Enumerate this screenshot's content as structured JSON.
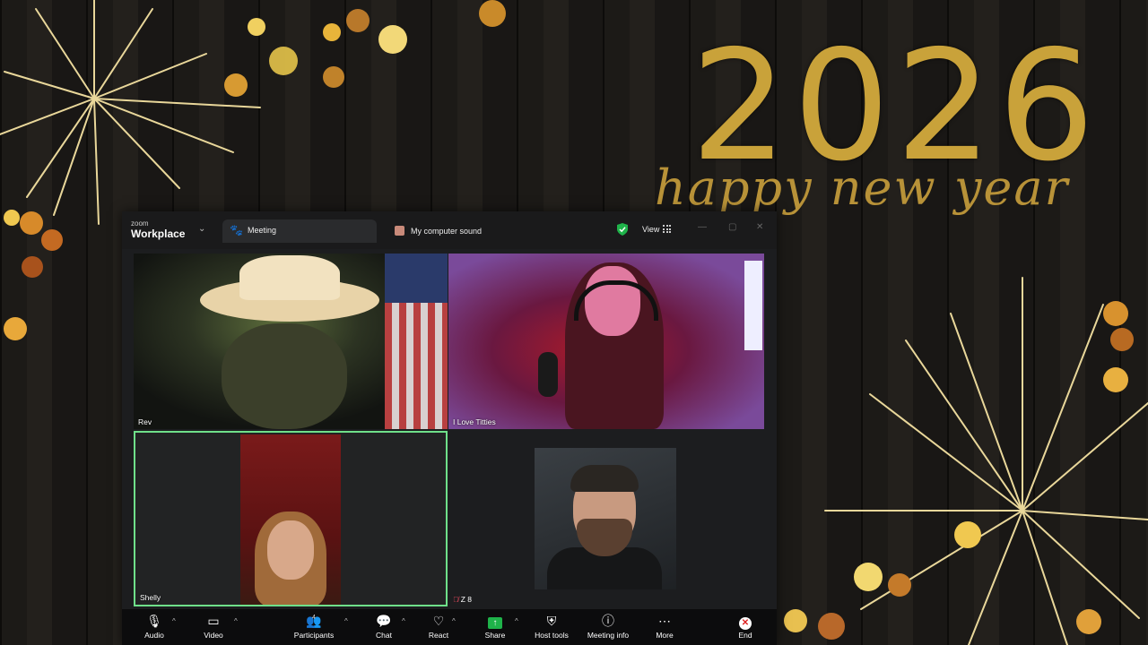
{
  "background": {
    "year": "2026",
    "greeting": "happy new year",
    "colors": {
      "gold": "#c9a23a",
      "wood": "#1c1a17"
    }
  },
  "window": {
    "brand_small": "zoom",
    "brand_big": "Workplace",
    "tabs": [
      {
        "label": "Meeting",
        "icon": "paw-icon",
        "active": true
      },
      {
        "label": "My computer sound",
        "icon": "sound-share-icon",
        "active": false
      }
    ],
    "view_label": "View"
  },
  "participants": [
    {
      "name": "Rev"
    },
    {
      "name": "I Love Titties"
    },
    {
      "name": "Shelly",
      "active_speaker": true
    },
    {
      "name": "Z 8",
      "muted": true
    }
  ],
  "toolbar": {
    "audio": "Audio",
    "video": "Video",
    "participants": "Participants",
    "participants_count": "4",
    "chat": "Chat",
    "react": "React",
    "share": "Share",
    "host_tools": "Host tools",
    "meeting_info": "Meeting info",
    "more": "More",
    "end": "End",
    "colors": {
      "share": "#1fb34a",
      "end": "#dd2222",
      "active_speaker_border": "#6fe08a"
    }
  }
}
